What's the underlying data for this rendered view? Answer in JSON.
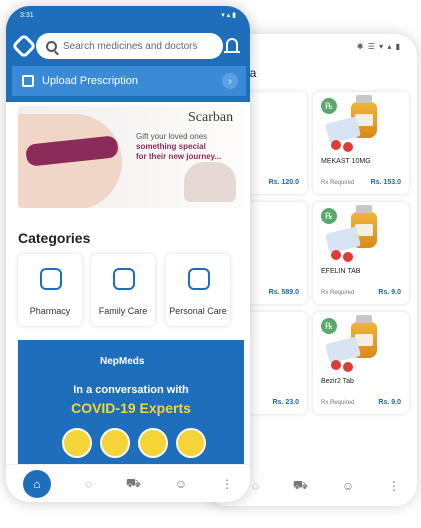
{
  "back_phone": {
    "status_icons": "✱ ☰ ▾ ▴ ▮",
    "header_fragment": "na",
    "cards": [
      {
        "name": "",
        "price": "Rs. 120.0",
        "rx": ""
      },
      {
        "name": "MEKAST 10MG",
        "price": "Rs. 153.0",
        "rx": "Rx Required"
      },
      {
        "name": "",
        "price": "Rs. 589.0",
        "rx": ""
      },
      {
        "name": "EFELIN TAB",
        "price": "Rs. 9.0",
        "rx": "Rx Required"
      },
      {
        "name": "",
        "price": "Rs. 23.0",
        "rx": ""
      },
      {
        "name": "Bezir2 Tab",
        "price": "Rs. 9.0",
        "rx": "Rx Required"
      }
    ],
    "nav_icons": [
      "chat-icon",
      "cart-icon",
      "profile-icon",
      "more-icon"
    ]
  },
  "front_phone": {
    "time": "3:31",
    "search_placeholder": "Search medicines and doctors",
    "upload_label": "Upload Prescription",
    "banner": {
      "brand": "Scarban",
      "tagline_1": "Gift your loved ones",
      "tagline_2": "something special",
      "tagline_3": "for their new journey..."
    },
    "categories_title": "Categories",
    "categories": [
      "Pharmacy",
      "Family Care",
      "Personal Care"
    ],
    "covid_banner": {
      "brand": "NepMeds",
      "line_1": "In a conversation with",
      "line_2": "COVID-19 Experts"
    },
    "nav_icons": [
      "home-icon",
      "chat-icon",
      "cart-icon",
      "profile-icon",
      "more-icon"
    ]
  }
}
